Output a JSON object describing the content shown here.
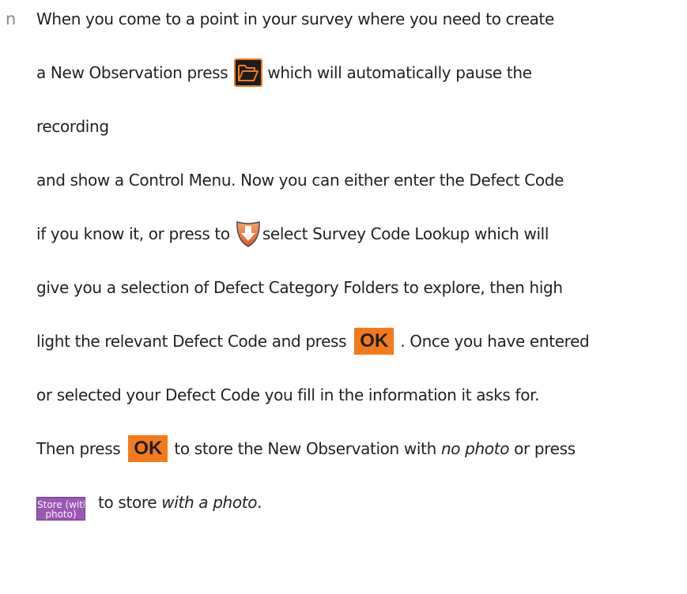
{
  "bullet_glyph": "n",
  "paragraph": {
    "line1": "When you come to a point in your survey where you need to create",
    "line2_before": "a New Observation press",
    "line2_after": "which will automatically pause the",
    "line3": "recording",
    "line4": "and show a Control Menu. Now you can either enter the Defect Code",
    "line5_before": "if you know it, or press to",
    "line5_after": "select Survey Code Lookup which will",
    "line6": "give you a selection of Defect Category Folders to explore, then high",
    "line7_before": "light the relevant Defect Code and press",
    "line7_after": ". Once you have entered",
    "line8": "or selected your Defect Code you fill in the information it asks for.",
    "line9_before": "Then press",
    "line9_middle": "to store the New Observation with",
    "line9_italic": "no photo",
    "line9_after": "or press",
    "line10_before": "to store",
    "line10_italic": "with a photo",
    "line10_after": "."
  },
  "buttons": {
    "ok_label": "OK",
    "store_with_photo_line1": "Store (with",
    "store_with_photo_line2": "photo)"
  },
  "icons": {
    "new_observation": "folder-open-icon",
    "survey_code_lookup": "shield-down-arrow-icon"
  },
  "colors": {
    "accent_orange": "#f37a1c",
    "folder_button_bg": "#1c1c1c",
    "store_button_bg": "#9a58b4",
    "text": "#222222",
    "bullet": "#8a8a8a"
  }
}
